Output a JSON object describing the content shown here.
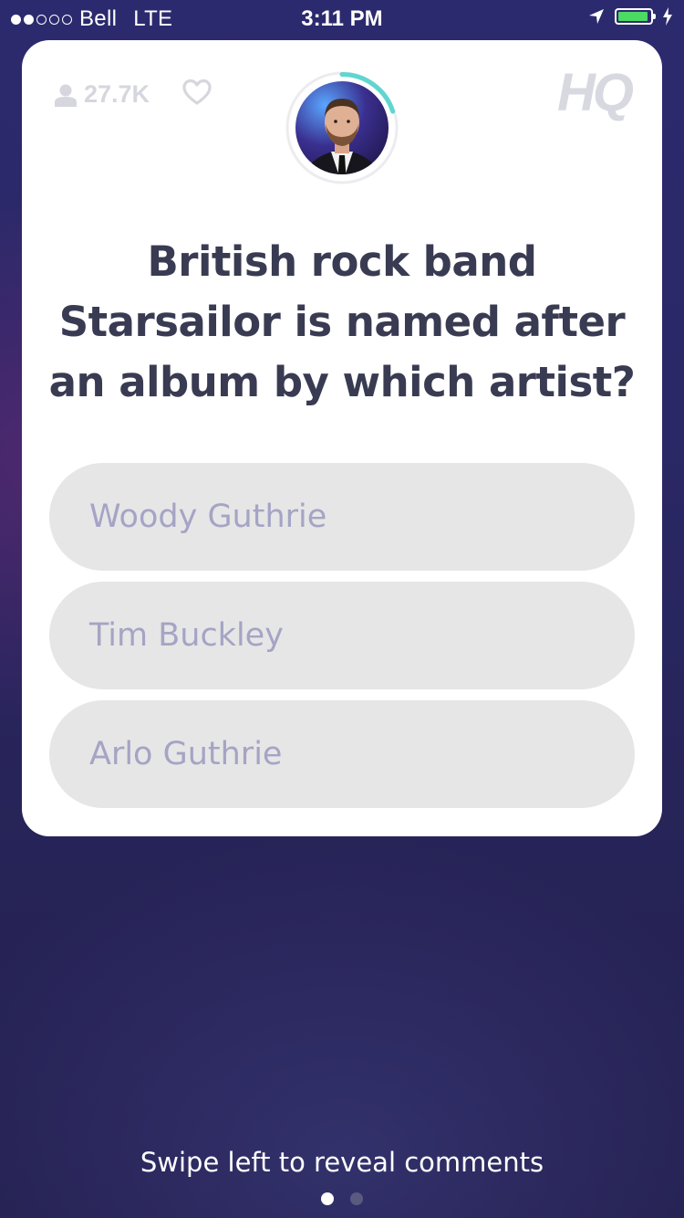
{
  "status_bar": {
    "signal_bars_filled": 2,
    "signal_bars_total": 5,
    "carrier": "Bell",
    "network": "LTE",
    "time": "3:11 PM",
    "battery_color": "#4cd964",
    "battery_level": 0.95
  },
  "card": {
    "viewer_count": "27.7K",
    "logo": "HQ",
    "timer_accent_color": "#5fd6d0",
    "timer_progress": 0.2,
    "question": "British rock band Starsailor is named after an album by which artist?",
    "answers": [
      {
        "label": "Woody Guthrie"
      },
      {
        "label": "Tim Buckley"
      },
      {
        "label": "Arlo Guthrie"
      }
    ]
  },
  "footer": {
    "hint": "Swipe left to reveal comments",
    "pages_total": 2,
    "page_active": 1
  },
  "colors": {
    "card_background": "#ffffff",
    "question_text": "#393b52",
    "answer_background": "#e6e6e6",
    "answer_text": "#a5a4c5",
    "background": "#2a2866"
  }
}
